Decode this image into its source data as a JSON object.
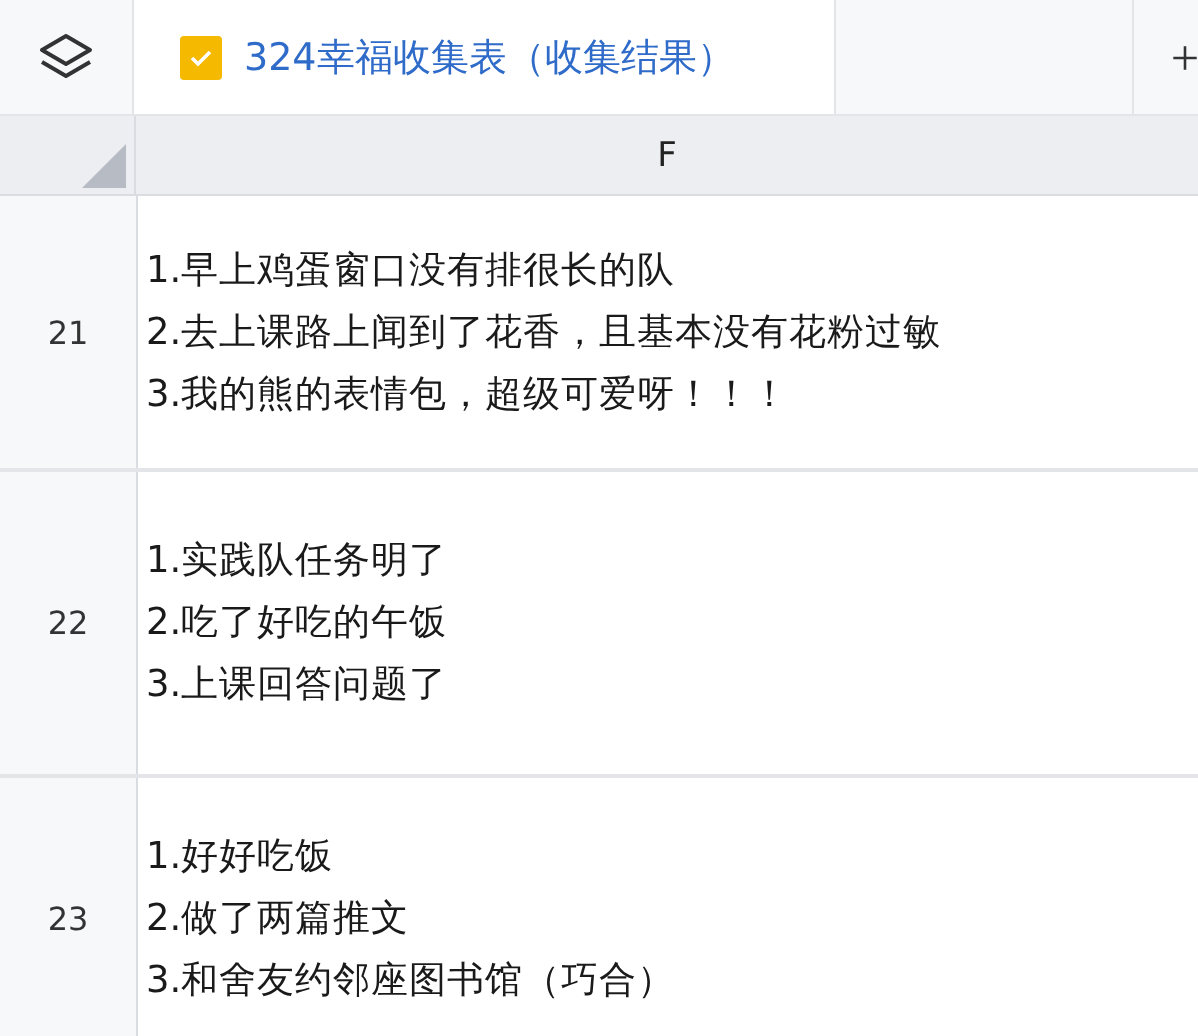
{
  "tabs": [
    {
      "label": "324幸福收集表（收集结果）",
      "selected": true
    }
  ],
  "table": {
    "columns": [
      "F"
    ],
    "rows": [
      {
        "number": "21",
        "lines": [
          "1.早上鸡蛋窗口没有排很长的队",
          "2.去上课路上闻到了花香，且基本没有花粉过敏",
          "3.我的熊的表情包，超级可爱呀！！！"
        ]
      },
      {
        "number": "22",
        "lines": [
          "1.实践队任务明了",
          "2.吃了好吃的午饭",
          "3.上课回答问题了"
        ]
      },
      {
        "number": "23",
        "lines": [
          "1.好好吃饭",
          "2.做了两篇推文",
          "3.和舍友约邻座图书馆（巧合）"
        ]
      }
    ]
  }
}
